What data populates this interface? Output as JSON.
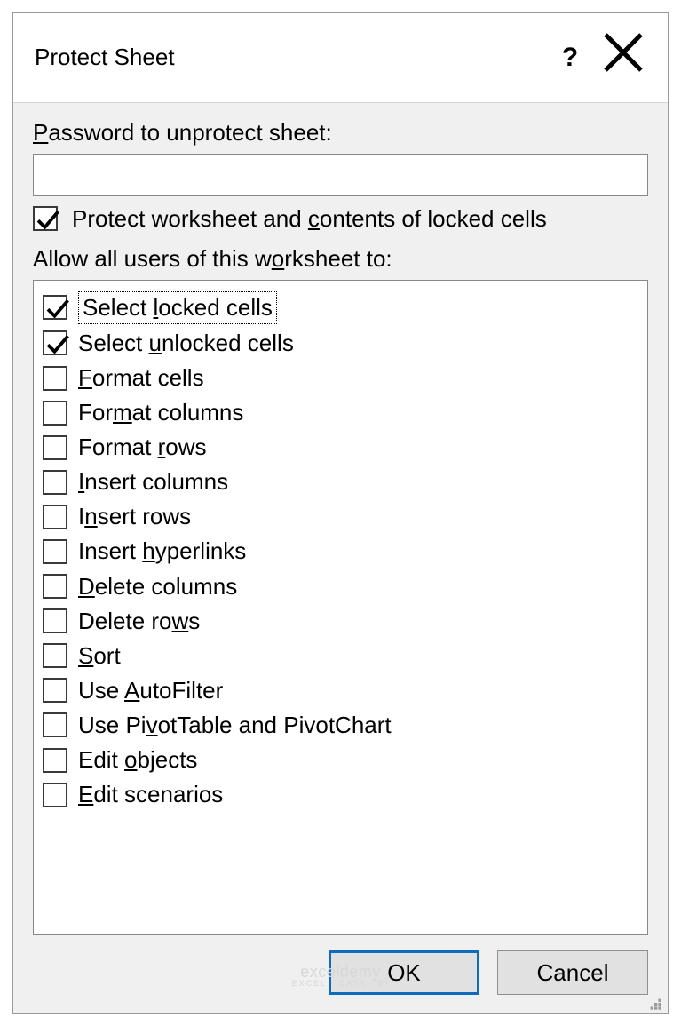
{
  "dialog": {
    "title": "Protect Sheet",
    "password_label_pre": "P",
    "password_label_post": "assword to unprotect sheet:",
    "protect_label_pre": "Protect worksheet and ",
    "protect_label_u": "c",
    "protect_label_post": "ontents of locked cells",
    "allow_label_pre": "Allow all users of this w",
    "allow_label_u": "o",
    "allow_label_post": "rksheet to:",
    "items": [
      {
        "checked": true,
        "focused": true,
        "pre": "Select ",
        "u": "l",
        "post": "ocked cells"
      },
      {
        "checked": true,
        "focused": false,
        "pre": "Select ",
        "u": "u",
        "post": "nlocked cells"
      },
      {
        "checked": false,
        "focused": false,
        "pre": "",
        "u": "F",
        "post": "ormat cells"
      },
      {
        "checked": false,
        "focused": false,
        "pre": "For",
        "u": "m",
        "post": "at columns"
      },
      {
        "checked": false,
        "focused": false,
        "pre": "Format ",
        "u": "r",
        "post": "ows"
      },
      {
        "checked": false,
        "focused": false,
        "pre": "",
        "u": "I",
        "post": "nsert columns"
      },
      {
        "checked": false,
        "focused": false,
        "pre": "I",
        "u": "n",
        "post": "sert rows"
      },
      {
        "checked": false,
        "focused": false,
        "pre": "Insert ",
        "u": "h",
        "post": "yperlinks"
      },
      {
        "checked": false,
        "focused": false,
        "pre": "",
        "u": "D",
        "post": "elete columns"
      },
      {
        "checked": false,
        "focused": false,
        "pre": "Delete ro",
        "u": "w",
        "post": "s"
      },
      {
        "checked": false,
        "focused": false,
        "pre": "",
        "u": "S",
        "post": "ort"
      },
      {
        "checked": false,
        "focused": false,
        "pre": "Use ",
        "u": "A",
        "post": "utoFilter"
      },
      {
        "checked": false,
        "focused": false,
        "pre": "Use Pi",
        "u": "v",
        "post": "otTable and PivotChart"
      },
      {
        "checked": false,
        "focused": false,
        "pre": "Edit ",
        "u": "o",
        "post": "bjects"
      },
      {
        "checked": false,
        "focused": false,
        "pre": "",
        "u": "E",
        "post": "dit scenarios"
      }
    ],
    "ok": "OK",
    "cancel": "Cancel"
  },
  "watermark": {
    "main": "exceldemy",
    "sub": "EXCEL · DATA · BI"
  }
}
